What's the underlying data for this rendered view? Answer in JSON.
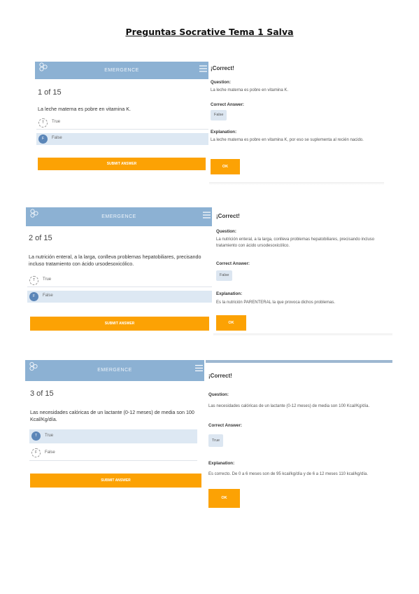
{
  "page_title": "Preguntas Socrative Tema 1 Salva",
  "app": {
    "header_label": "EMERGENCE",
    "submit_label": "SUBMIT ANSWER",
    "ok_label": "OK"
  },
  "questions": [
    {
      "counter": "1 of 15",
      "text": "La leche materna es pobre en vitamina K.",
      "options": [
        {
          "letter": "T",
          "label": "True",
          "selected": false
        },
        {
          "letter": "F",
          "label": "False",
          "selected": true
        }
      ],
      "result": {
        "heading": "¡Correct!",
        "question_label": "Question:",
        "question": "La leche materna es pobre en vitamina K.",
        "answer_label": "Correct Answer:",
        "answer": "False",
        "explanation_label": "Explanation:",
        "explanation": "La leche materna es pobre en vitamina K, por eso se suplementa al recién nacido."
      }
    },
    {
      "counter": "2 of 15",
      "text": "La nutrición enteral, a la larga, conlleva problemas hepatobiliares, precisando incluso tratamiento con ácido ursodesoxicólico.",
      "options": [
        {
          "letter": "T",
          "label": "True",
          "selected": false
        },
        {
          "letter": "F",
          "label": "False",
          "selected": true
        }
      ],
      "result": {
        "heading": "¡Correct!",
        "question_label": "Question:",
        "question": "La nutrición enteral, a la larga, conlleva problemas hepatobiliares, precisando incluso tratamiento con ácido ursodesoxicólico.",
        "answer_label": "Correct Answer:",
        "answer": "False",
        "explanation_label": "Explanation:",
        "explanation": "Es la nutrición PARENTERAL la que provoca dichos problemas."
      }
    },
    {
      "counter": "3 of 15",
      "text": "Las necesidades calóricas de un lactante (0-12 meses) de media son 100 Kcal/Kg/día.",
      "options": [
        {
          "letter": "T",
          "label": "True",
          "selected": true
        },
        {
          "letter": "F",
          "label": "False",
          "selected": false
        }
      ],
      "result": {
        "heading": "¡Correct!",
        "question_label": "Question:",
        "question": "Las necesidades calóricas de un lactante (0-12 meses) de media son 100 Kcal/Kg/día.",
        "answer_label": "Correct Answer:",
        "answer": "True",
        "explanation_label": "Explanation:",
        "explanation": "Es correcto. De 0 a 6 meses son de 95 kcal/kg/día y de 6 a 12 meses 110 kcal/kg/día."
      }
    }
  ]
}
